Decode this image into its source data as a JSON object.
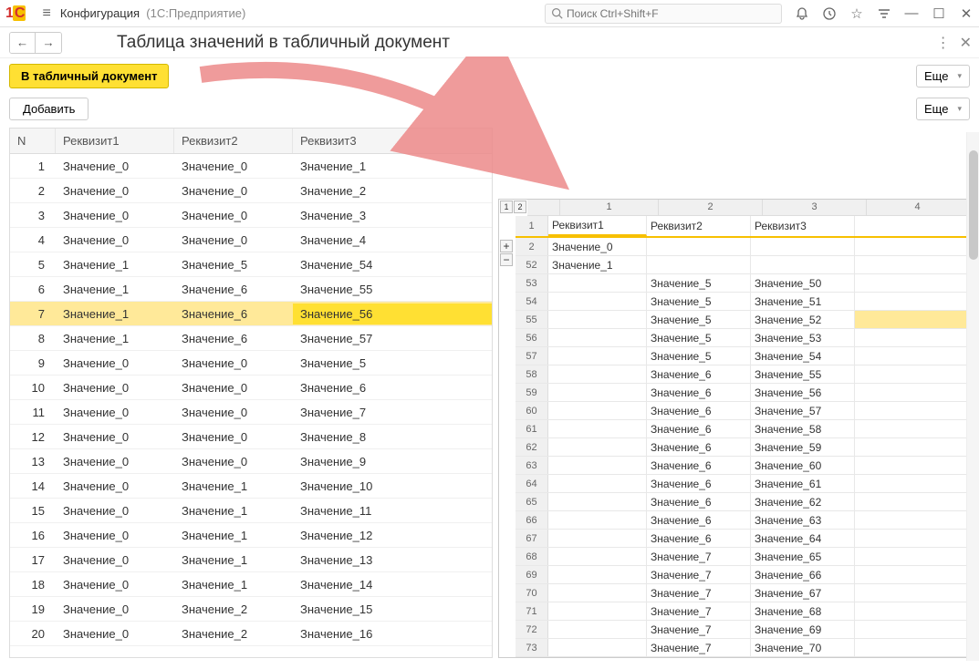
{
  "titlebar": {
    "app_name": "Конфигурация",
    "app_context": "(1С:Предприятие)",
    "search_placeholder": "Поиск Ctrl+Shift+F"
  },
  "page": {
    "title": "Таблица значений в табличный документ"
  },
  "toolbar": {
    "to_spreadsheet": "В табличный документ",
    "more": "Еще",
    "add": "Добавить"
  },
  "left_table": {
    "headers": {
      "n": "N",
      "r1": "Реквизит1",
      "r2": "Реквизит2",
      "r3": "Реквизит3"
    },
    "selected_index": 6,
    "rows": [
      {
        "n": 1,
        "r1": "Значение_0",
        "r2": "Значение_0",
        "r3": "Значение_1"
      },
      {
        "n": 2,
        "r1": "Значение_0",
        "r2": "Значение_0",
        "r3": "Значение_2"
      },
      {
        "n": 3,
        "r1": "Значение_0",
        "r2": "Значение_0",
        "r3": "Значение_3"
      },
      {
        "n": 4,
        "r1": "Значение_0",
        "r2": "Значение_0",
        "r3": "Значение_4"
      },
      {
        "n": 5,
        "r1": "Значение_1",
        "r2": "Значение_5",
        "r3": "Значение_54"
      },
      {
        "n": 6,
        "r1": "Значение_1",
        "r2": "Значение_6",
        "r3": "Значение_55"
      },
      {
        "n": 7,
        "r1": "Значение_1",
        "r2": "Значение_6",
        "r3": "Значение_56"
      },
      {
        "n": 8,
        "r1": "Значение_1",
        "r2": "Значение_6",
        "r3": "Значение_57"
      },
      {
        "n": 9,
        "r1": "Значение_0",
        "r2": "Значение_0",
        "r3": "Значение_5"
      },
      {
        "n": 10,
        "r1": "Значение_0",
        "r2": "Значение_0",
        "r3": "Значение_6"
      },
      {
        "n": 11,
        "r1": "Значение_0",
        "r2": "Значение_0",
        "r3": "Значение_7"
      },
      {
        "n": 12,
        "r1": "Значение_0",
        "r2": "Значение_0",
        "r3": "Значение_8"
      },
      {
        "n": 13,
        "r1": "Значение_0",
        "r2": "Значение_0",
        "r3": "Значение_9"
      },
      {
        "n": 14,
        "r1": "Значение_0",
        "r2": "Значение_1",
        "r3": "Значение_10"
      },
      {
        "n": 15,
        "r1": "Значение_0",
        "r2": "Значение_1",
        "r3": "Значение_11"
      },
      {
        "n": 16,
        "r1": "Значение_0",
        "r2": "Значение_1",
        "r3": "Значение_12"
      },
      {
        "n": 17,
        "r1": "Значение_0",
        "r2": "Значение_1",
        "r3": "Значение_13"
      },
      {
        "n": 18,
        "r1": "Значение_0",
        "r2": "Значение_1",
        "r3": "Значение_14"
      },
      {
        "n": 19,
        "r1": "Значение_0",
        "r2": "Значение_2",
        "r3": "Значение_15"
      },
      {
        "n": 20,
        "r1": "Значение_0",
        "r2": "Значение_2",
        "r3": "Значение_16"
      }
    ]
  },
  "spreadsheet": {
    "col_labels": [
      "1",
      "2",
      "3",
      "4"
    ],
    "header_row": {
      "rownum": "1",
      "c1": "Реквизит1",
      "c2": "Реквизит2",
      "c3": "Реквизит3"
    },
    "selected_row": 55,
    "rows": [
      {
        "rownum": "2",
        "c1": "Значение_0",
        "c2": "",
        "c3": ""
      },
      {
        "rownum": "52",
        "c1": "Значение_1",
        "c2": "",
        "c3": ""
      },
      {
        "rownum": "53",
        "c1": "",
        "c2": "Значение_5",
        "c3": "Значение_50"
      },
      {
        "rownum": "54",
        "c1": "",
        "c2": "Значение_5",
        "c3": "Значение_51"
      },
      {
        "rownum": "55",
        "c1": "",
        "c2": "Значение_5",
        "c3": "Значение_52"
      },
      {
        "rownum": "56",
        "c1": "",
        "c2": "Значение_5",
        "c3": "Значение_53"
      },
      {
        "rownum": "57",
        "c1": "",
        "c2": "Значение_5",
        "c3": "Значение_54"
      },
      {
        "rownum": "58",
        "c1": "",
        "c2": "Значение_6",
        "c3": "Значение_55"
      },
      {
        "rownum": "59",
        "c1": "",
        "c2": "Значение_6",
        "c3": "Значение_56"
      },
      {
        "rownum": "60",
        "c1": "",
        "c2": "Значение_6",
        "c3": "Значение_57"
      },
      {
        "rownum": "61",
        "c1": "",
        "c2": "Значение_6",
        "c3": "Значение_58"
      },
      {
        "rownum": "62",
        "c1": "",
        "c2": "Значение_6",
        "c3": "Значение_59"
      },
      {
        "rownum": "63",
        "c1": "",
        "c2": "Значение_6",
        "c3": "Значение_60"
      },
      {
        "rownum": "64",
        "c1": "",
        "c2": "Значение_6",
        "c3": "Значение_61"
      },
      {
        "rownum": "65",
        "c1": "",
        "c2": "Значение_6",
        "c3": "Значение_62"
      },
      {
        "rownum": "66",
        "c1": "",
        "c2": "Значение_6",
        "c3": "Значение_63"
      },
      {
        "rownum": "67",
        "c1": "",
        "c2": "Значение_6",
        "c3": "Значение_64"
      },
      {
        "rownum": "68",
        "c1": "",
        "c2": "Значение_7",
        "c3": "Значение_65"
      },
      {
        "rownum": "69",
        "c1": "",
        "c2": "Значение_7",
        "c3": "Значение_66"
      },
      {
        "rownum": "70",
        "c1": "",
        "c2": "Значение_7",
        "c3": "Значение_67"
      },
      {
        "rownum": "71",
        "c1": "",
        "c2": "Значение_7",
        "c3": "Значение_68"
      },
      {
        "rownum": "72",
        "c1": "",
        "c2": "Значение_7",
        "c3": "Значение_69"
      },
      {
        "rownum": "73",
        "c1": "",
        "c2": "Значение_7",
        "c3": "Значение_70"
      }
    ]
  }
}
